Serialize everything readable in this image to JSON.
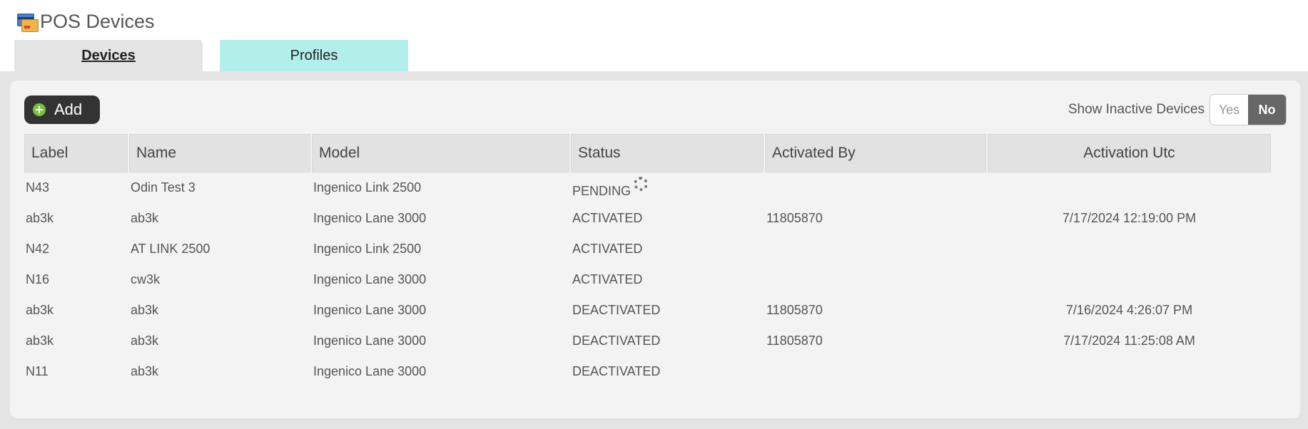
{
  "header": {
    "title": "POS Devices",
    "icon": "pos-devices-icon"
  },
  "tabs": [
    {
      "label": "Devices",
      "active": true
    },
    {
      "label": "Profiles",
      "active": false
    }
  ],
  "toolbar": {
    "add_label": "Add",
    "add_icon": "plus-circle-icon"
  },
  "inactive_filter": {
    "label": "Show Inactive Devices",
    "yes": "Yes",
    "no": "No",
    "selected": "No"
  },
  "table": {
    "columns": [
      "Label",
      "Name",
      "Model",
      "Status",
      "Activated By",
      "Activation Utc"
    ],
    "rows": [
      [
        "N43",
        "Odin Test 3",
        "Ingenico Link 2500",
        "PENDING",
        "",
        ""
      ],
      [
        "ab3k",
        "ab3k",
        "Ingenico Lane 3000",
        "ACTIVATED",
        "11805870",
        "7/17/2024 12:19:00 PM"
      ],
      [
        "N42",
        "AT LINK 2500",
        "Ingenico Link 2500",
        "ACTIVATED",
        "",
        ""
      ],
      [
        "N16",
        "cw3k",
        "Ingenico Lane 3000",
        "ACTIVATED",
        "",
        ""
      ],
      [
        "ab3k",
        "ab3k",
        "Ingenico Lane 3000",
        "DEACTIVATED",
        "11805870",
        "7/16/2024 4:26:07 PM"
      ],
      [
        "ab3k",
        "ab3k",
        "Ingenico Lane 3000",
        "DEACTIVATED",
        "11805870",
        "7/17/2024 11:25:08 AM"
      ],
      [
        "N11",
        "ab3k",
        "Ingenico Lane 3000",
        "DEACTIVATED",
        "",
        ""
      ]
    ]
  },
  "colors": {
    "profiles_tab": "#b3efea",
    "add_button": "#333333",
    "toggle_selected": "#666666"
  }
}
